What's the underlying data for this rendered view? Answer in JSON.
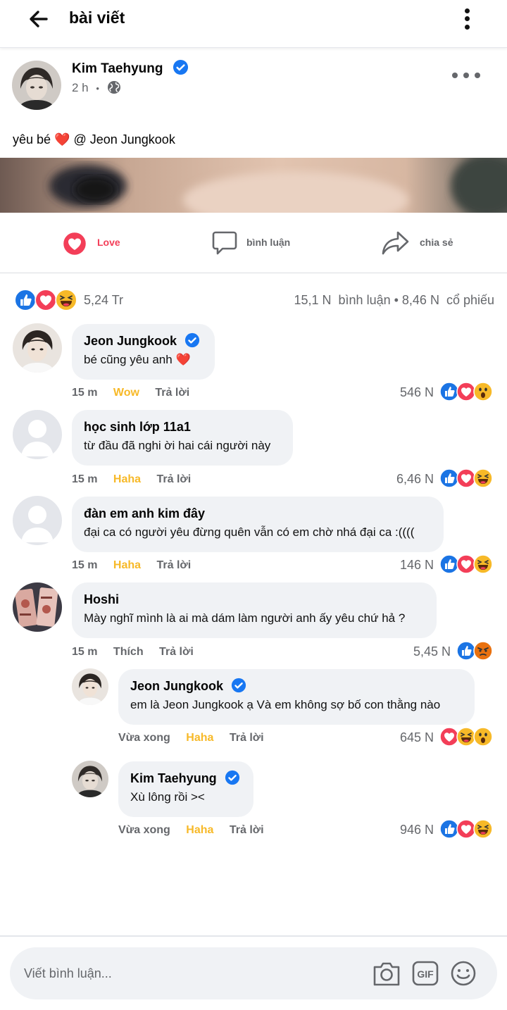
{
  "header": {
    "title": "bài viết"
  },
  "post": {
    "author": "Kim Taehyung",
    "time": "2 h",
    "separator": "•",
    "caption": "yêu bé ❤️ @ Jeon Jungkook"
  },
  "actions": {
    "love": "Love",
    "comment": "bình luận",
    "share": "chia sẻ"
  },
  "stats": {
    "reactions": "5,24 Tr",
    "comments": "15,1 N  bình luận • 8,46 N  cổ phiếu"
  },
  "comments": [
    {
      "name": "Jeon Jungkook",
      "verified": true,
      "text": "bé cũng yêu anh ❤️",
      "time": "15 m",
      "reaction": "Wow",
      "reaction_color": "#f7b928",
      "reply": "Trả lời",
      "count": "546 N",
      "icons": [
        "like-icon",
        "love-icon",
        "wow-icon"
      ]
    },
    {
      "name": "học sinh lớp 11a1",
      "verified": false,
      "text": "từ đầu đã nghi ời hai cái người này",
      "time": "15 m",
      "reaction": "Haha",
      "reaction_color": "#f7b928",
      "reply": "Trả lời",
      "count": "6,46 N",
      "icons": [
        "like-icon",
        "love-icon",
        "haha-icon"
      ]
    },
    {
      "name": "đàn em anh kim đây",
      "verified": false,
      "text": "đại ca có người yêu đừng quên vẫn có em chờ nhá đại ca :((((",
      "time": "15 m",
      "reaction": "Haha",
      "reaction_color": "#f7b928",
      "reply": "Trả lời",
      "count": "146 N",
      "icons": [
        "like-icon",
        "love-icon",
        "haha-icon"
      ]
    },
    {
      "name": "Hoshi",
      "verified": false,
      "text": "Mày nghĩ mình là ai mà dám làm người anh ấy yêu chứ hả ?",
      "time": "15 m",
      "reaction": "Thích",
      "reaction_color": "#65676b",
      "reply": "Trả lời",
      "count": "5,45 N",
      "icons": [
        "like-icon",
        "angry-icon"
      ]
    }
  ],
  "replies": [
    {
      "name": "Jeon Jungkook",
      "verified": true,
      "text": "em là Jeon Jungkook ạ Và em không sợ bố con thằng nào",
      "time": "Vừa xong",
      "reaction": "Haha",
      "reaction_color": "#f7b928",
      "reply": "Trả lời",
      "count": "645 N",
      "icons": [
        "love-icon",
        "haha-icon",
        "wow-icon"
      ]
    },
    {
      "name": "Kim Taehyung",
      "verified": true,
      "text": "Xù lông rồi ><",
      "time": "Vừa xong",
      "reaction": "Haha",
      "reaction_color": "#f7b928",
      "reply": "Trả lời",
      "count": "946 N",
      "icons": [
        "like-icon",
        "love-icon",
        "haha-icon"
      ]
    }
  ],
  "composer": {
    "placeholder": "Viết bình luận..."
  },
  "colors": {
    "verified": "#1877f2",
    "like": "#1b74e4",
    "love": "#f33e58",
    "reaction_yellow": "#f7b928",
    "text_secondary": "#65676b",
    "bubble": "#f0f2f5"
  }
}
